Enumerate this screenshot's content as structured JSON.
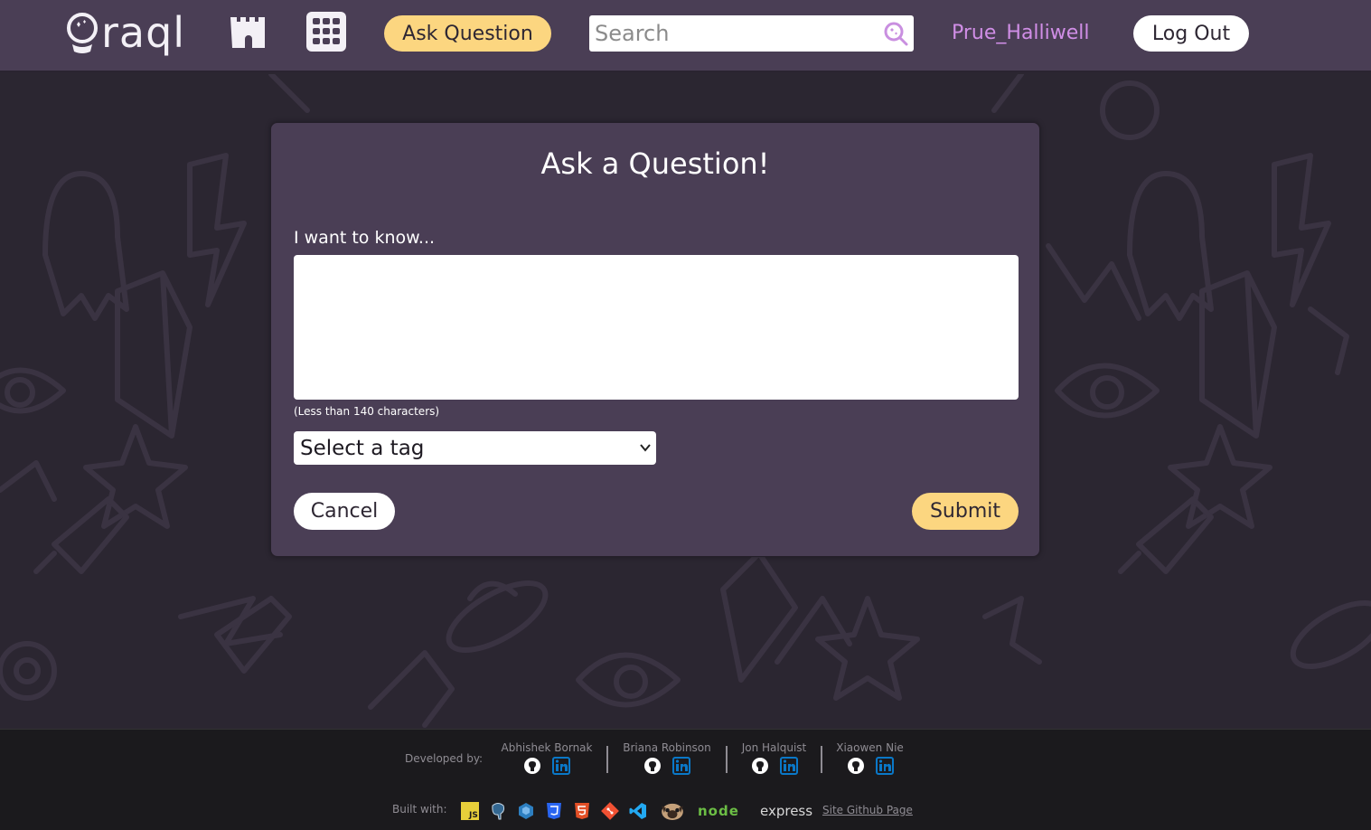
{
  "header": {
    "logo_text": "raql",
    "ask_button": "Ask Question",
    "search_placeholder": "Search",
    "username": "Prue_Halliwell",
    "logout_button": "Log Out"
  },
  "form": {
    "title": "Ask a Question!",
    "prompt_label": "I want to know...",
    "question_value": "",
    "hint": "(Less than 140 characters)",
    "tag_select": "Select a tag",
    "cancel_button": "Cancel",
    "submit_button": "Submit"
  },
  "footer": {
    "developed_by": "Developed by:",
    "developers": [
      {
        "name": "Abhishek Bornak"
      },
      {
        "name": "Briana Robinson"
      },
      {
        "name": "Jon Halquist"
      },
      {
        "name": "Xiaowen Nie"
      }
    ],
    "built_with": "Built with:",
    "tech": [
      "js-icon",
      "postgresql-icon",
      "sequelize-icon",
      "css3-icon",
      "html5-icon",
      "git-icon",
      "vscode-icon",
      "pug-icon",
      "nodejs-icon",
      "express-icon"
    ],
    "node_label": "node",
    "express_label": "express",
    "site_link": "Site Github Page"
  },
  "colors": {
    "header_bg": "#4a3e55",
    "page_bg": "#2b2631",
    "card_bg": "#4a3e55",
    "accent_yellow": "#fcd680",
    "username_purple": "#d08ee6",
    "footer_bg": "#1b1a1d"
  }
}
